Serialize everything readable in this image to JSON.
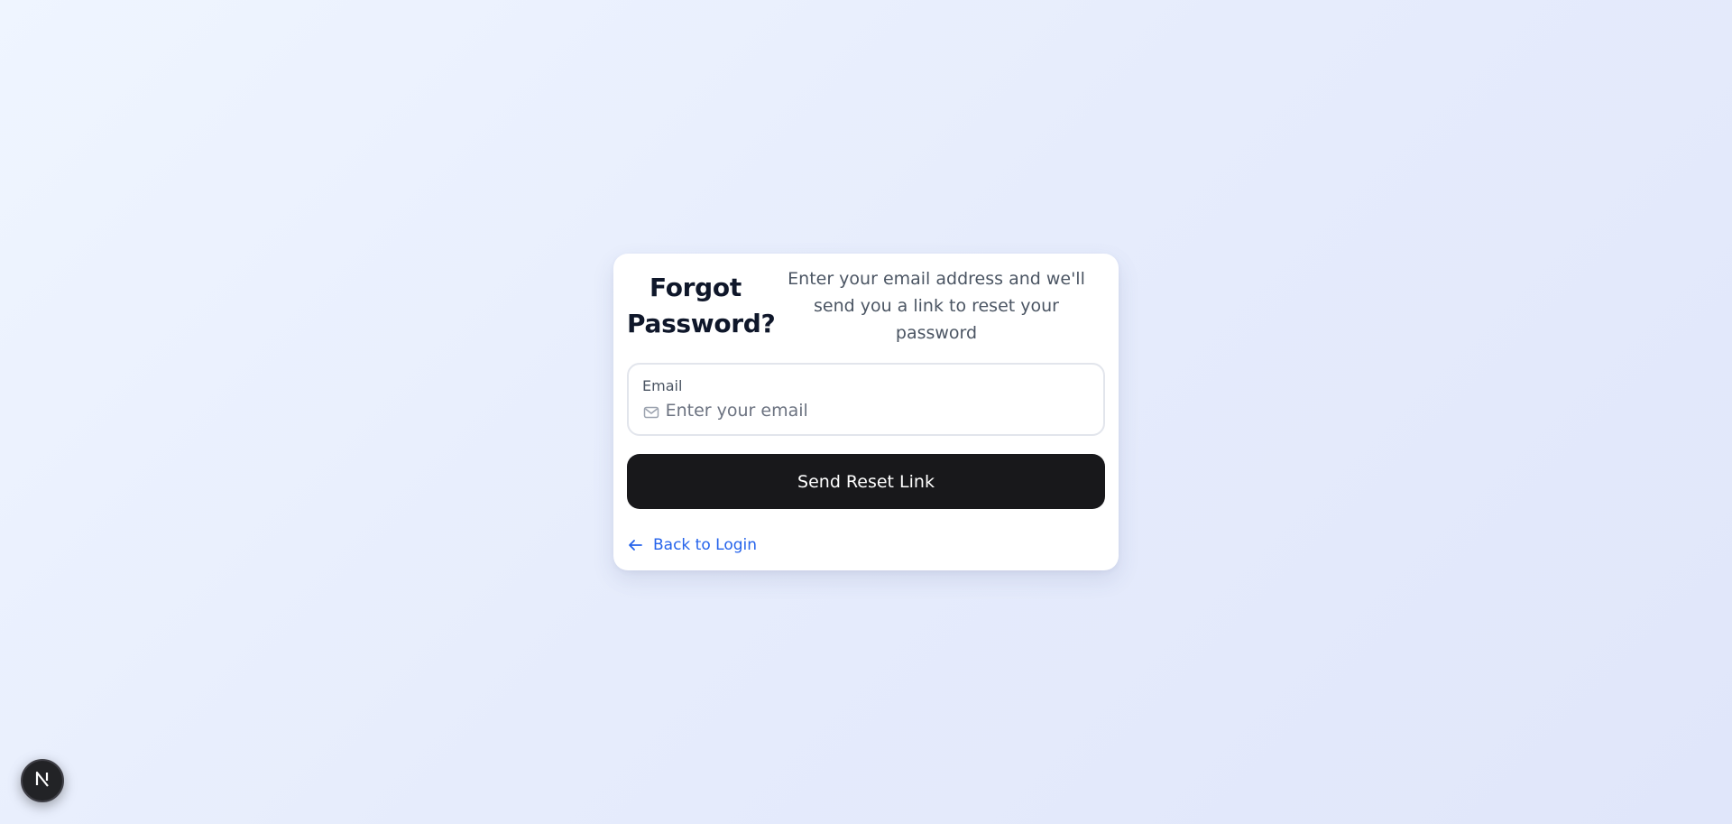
{
  "card": {
    "title": "Forgot Password?",
    "subtitle": "Enter your email address and we'll send you a link to reset your password"
  },
  "email_field": {
    "label": "Email",
    "placeholder": "Enter your email",
    "value": "",
    "icon": "mail-icon"
  },
  "submit_button": {
    "label": "Send Reset Link"
  },
  "back_link": {
    "label": "Back to Login",
    "icon": "arrow-left-icon"
  },
  "dev_badge": {
    "icon": "nextjs-logo-icon"
  },
  "colors": {
    "button_bg": "#18181b",
    "link": "#2563eb",
    "title": "#0f172a",
    "subtitle": "#4b5563",
    "background_start": "#eff5ff",
    "background_end": "#e0e6fa"
  }
}
